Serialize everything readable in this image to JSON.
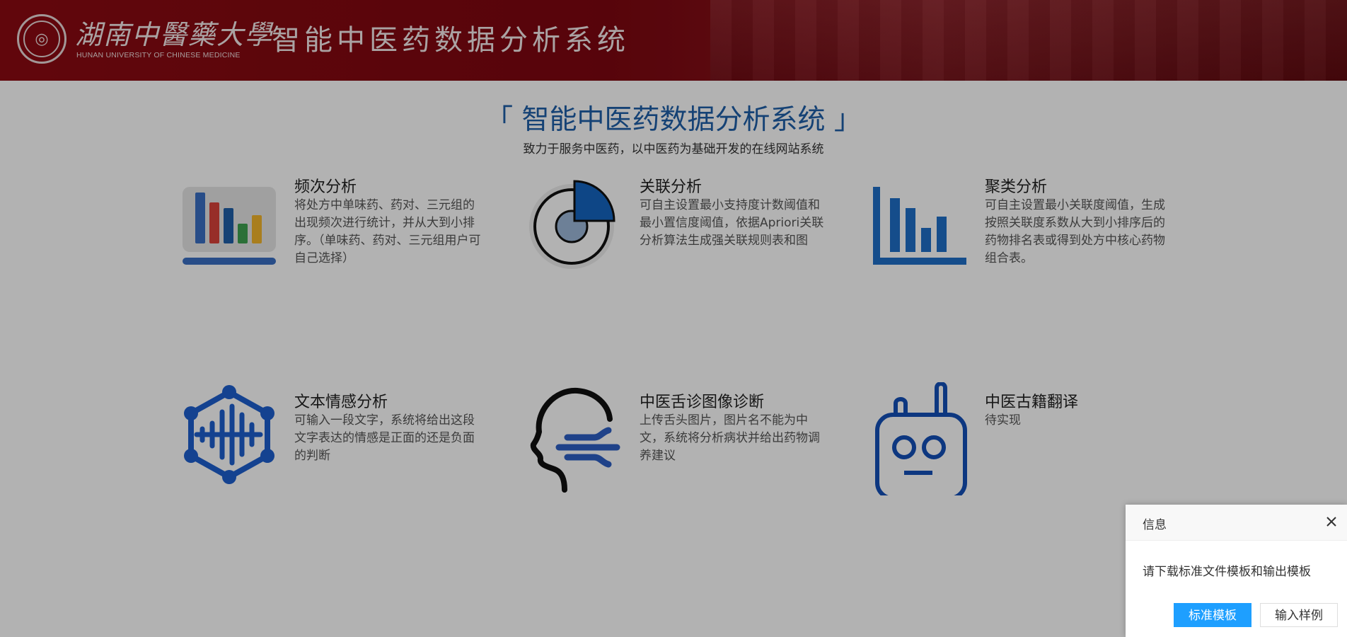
{
  "header": {
    "university_name": "湖南中醫藥大學",
    "university_en": "HUNAN UNIVERSITY OF CHINESE MEDICINE",
    "system_title": "智能中医药数据分析系统"
  },
  "main": {
    "title": "「 智能中医药数据分析系统 」",
    "subtitle": "致力于服务中医药，以中医药为基础开发的在线网站系统",
    "cards": [
      {
        "title": "频次分析",
        "desc": "将处方中单味药、药对、三元组的出现频次进行统计，并从大到小排序。（单味药、药对、三元组用户可自己选择）",
        "icon": "bar-chart-icon"
      },
      {
        "title": "关联分析",
        "desc": "可自主设置最小支持度计数阈值和最小置信度阈值，依据Apriori关联分析算法生成强关联规则表和图",
        "icon": "pie-chart-icon"
      },
      {
        "title": "聚类分析",
        "desc": "可自主设置最小关联度阈值，生成按照关联度系数从大到小排序后的药物排名表或得到处方中核心药物组合表。",
        "icon": "column-chart-icon"
      },
      {
        "title": "文本情感分析",
        "desc": "可输入一段文字，系统将给出这段文字表达的情感是正面的还是负面的判断",
        "icon": "network-waveform-icon"
      },
      {
        "title": "中医舌诊图像诊断",
        "desc": "上传舌头图片，图片名不能为中文，系统将分析病状并给出药物调养建议",
        "icon": "head-speech-icon"
      },
      {
        "title": "中医古籍翻译",
        "desc": "待实现",
        "icon": "robot-icon"
      }
    ]
  },
  "dialog": {
    "title": "信息",
    "message": "请下载标准文件模板和输出模板",
    "primary_button": "标准模板",
    "secondary_button": "输入样例"
  }
}
